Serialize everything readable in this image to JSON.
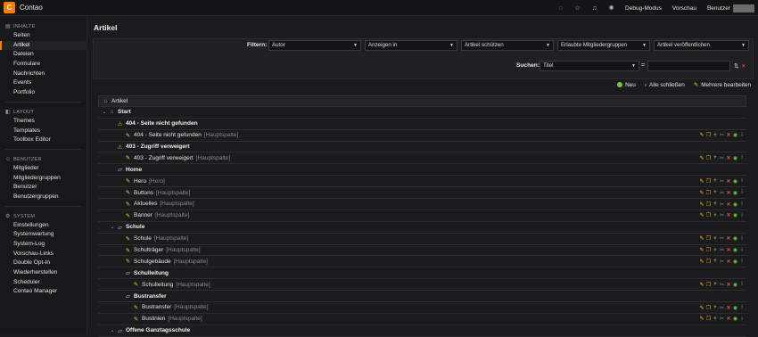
{
  "app": {
    "title": "Contao",
    "logo_letter": "C",
    "brand_color": "#f47c00"
  },
  "topbar": {
    "icons": [
      "help-icon",
      "star-icon",
      "bell-icon",
      "color-scheme-icon"
    ],
    "links": [
      "Debug-Modus",
      "Vorschau",
      "Benutzer"
    ]
  },
  "sidebar": {
    "groups": [
      {
        "title": "Inhalte",
        "icon": "content-icon",
        "items": [
          "Seiten",
          "Artikel",
          "Dateien",
          "Formulare",
          "Nachrichten",
          "Events",
          "Portfolio"
        ]
      },
      {
        "title": "Layout",
        "icon": "layout-icon",
        "items": [
          "Themes",
          "Templates",
          "Toolbox Editor"
        ]
      },
      {
        "title": "Benutzer",
        "icon": "users-icon",
        "items": [
          "Mitglieder",
          "Mitgliedergruppen",
          "Benutzer",
          "Benutzergruppen"
        ]
      },
      {
        "title": "System",
        "icon": "system-icon",
        "items": [
          "Einstellungen",
          "Systemwartung",
          "System-Log",
          "Vorschau-Links",
          "Double Opt-In",
          "Wiederherstellen",
          "Scheduler",
          "Contao Manager"
        ]
      }
    ],
    "active_item": "Artikel"
  },
  "main": {
    "title": "Artikel"
  },
  "filter": {
    "label": "Filtern:",
    "selects": [
      "Autor",
      "Anzeigen in",
      "Artikel schützen",
      "Erlaubte Mitgliedergruppen",
      "Artikel veröffentlichen"
    ],
    "search_label": "Suchen:",
    "search_field": "Titel",
    "eq": "="
  },
  "actions": {
    "new": "Neu",
    "collapse_all": "Alle schließen",
    "edit_multiple": "Mehrere bearbeiten"
  },
  "tree": {
    "root_label": "Artikel",
    "rows": [
      {
        "type": "page",
        "icon": "root-icon",
        "label": "Start",
        "meta": "",
        "level": 0,
        "toggle": "⌄"
      },
      {
        "type": "page",
        "icon": "warning-icon",
        "label": "404 - Seite nicht gefunden",
        "meta": "",
        "level": 1,
        "toggle": ""
      },
      {
        "type": "article",
        "icon": "article-icon",
        "label": "404 - Seite nicht gefunden",
        "meta": "[Hauptspalte]",
        "level": 2
      },
      {
        "type": "page",
        "icon": "warning-icon",
        "label": "403 - Zugriff verweigert",
        "meta": "",
        "level": 1,
        "toggle": ""
      },
      {
        "type": "article",
        "icon": "article-icon",
        "label": "403 - Zugriff verweigert",
        "meta": "[Hauptspalte]",
        "level": 2
      },
      {
        "type": "page",
        "icon": "page-icon",
        "label": "Home",
        "meta": "",
        "level": 1,
        "toggle": ""
      },
      {
        "type": "article",
        "icon": "article-icon",
        "label": "Hero",
        "meta": "[Hero]",
        "level": 2
      },
      {
        "type": "article",
        "icon": "article-icon",
        "label": "Buttons",
        "meta": "[Hauptspalte]",
        "level": 2
      },
      {
        "type": "article",
        "icon": "article-icon",
        "label": "Aktuelles",
        "meta": "[Hauptspalte]",
        "level": 2
      },
      {
        "type": "article",
        "icon": "article-icon",
        "label": "Banner",
        "meta": "[Hauptspalte]",
        "level": 2
      },
      {
        "type": "page",
        "icon": "page-icon",
        "label": "Schule",
        "meta": "",
        "level": 1,
        "toggle": "⌄"
      },
      {
        "type": "article",
        "icon": "article-icon",
        "label": "Schule",
        "meta": "[Hauptspalte]",
        "level": 2
      },
      {
        "type": "article",
        "icon": "article-icon",
        "label": "Schulträger",
        "meta": "[Hauptspalte]",
        "level": 2
      },
      {
        "type": "article",
        "icon": "article-icon",
        "label": "Schulgebäude",
        "meta": "[Hauptspalte]",
        "level": 2
      },
      {
        "type": "page",
        "icon": "page-icon",
        "label": "Schulleitung",
        "meta": "",
        "level": 2,
        "toggle": ""
      },
      {
        "type": "article",
        "icon": "article-icon",
        "label": "Schulleitung",
        "meta": "[Hauptspalte]",
        "level": 3
      },
      {
        "type": "page",
        "icon": "page-icon",
        "label": "Bustransfer",
        "meta": "",
        "level": 2,
        "toggle": ""
      },
      {
        "type": "article",
        "icon": "article-icon",
        "label": "Bustransfer",
        "meta": "[Hauptspalte]",
        "level": 3
      },
      {
        "type": "article",
        "icon": "article-icon",
        "label": "Buslinien",
        "meta": "[Hauptspalte]",
        "level": 3
      },
      {
        "type": "page",
        "icon": "page-icon",
        "label": "Offene Ganztagsschule",
        "meta": "",
        "level": 1,
        "toggle": "⌄"
      }
    ],
    "operation_icons": [
      "edit-icon",
      "copy-icon",
      "paste-after-icon",
      "cut-icon",
      "delete-icon",
      "toggle-visibility-icon",
      "info-icon"
    ]
  }
}
